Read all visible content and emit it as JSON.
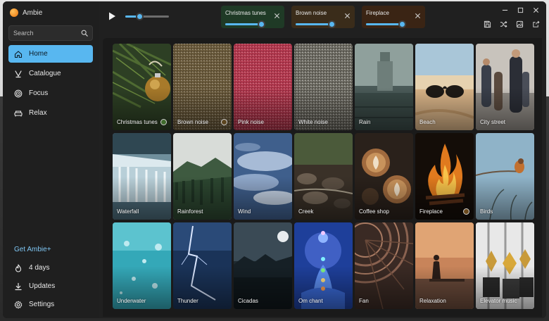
{
  "app": {
    "title": "Ambie"
  },
  "search": {
    "placeholder": "Search"
  },
  "nav": [
    {
      "label": "Home",
      "icon": "home-icon",
      "active": true
    },
    {
      "label": "Catalogue",
      "icon": "catalogue-icon",
      "active": false
    },
    {
      "label": "Focus",
      "icon": "focus-icon",
      "active": false
    },
    {
      "label": "Relax",
      "icon": "relax-icon",
      "active": false
    }
  ],
  "bottom_nav": {
    "get_plus": "Get Ambie+",
    "streak": "4 days",
    "updates": "Updates",
    "settings": "Settings"
  },
  "player": {
    "master_volume": 0.32
  },
  "active_sounds": [
    {
      "name": "Christmas tunes",
      "volume": 0.93,
      "tint": "#1f3a26"
    },
    {
      "name": "Brown noise",
      "volume": 0.93,
      "tint": "#3a2c1a"
    },
    {
      "name": "Fireplace",
      "volume": 0.93,
      "tint": "#3a2414"
    }
  ],
  "colors": {
    "accent": "#58b7f0",
    "window": "#1c1c1c",
    "sidebar": "#1f1f1f"
  },
  "sounds": [
    {
      "name": "Christmas tunes",
      "art": "christmas",
      "playing": true,
      "dot": "#3f6b2c"
    },
    {
      "name": "Brown noise",
      "art": "brown",
      "playing": true,
      "dot": "#5c4520"
    },
    {
      "name": "Pink noise",
      "art": "pink",
      "playing": false
    },
    {
      "name": "White noise",
      "art": "white",
      "playing": false
    },
    {
      "name": "Rain",
      "art": "rain",
      "playing": false
    },
    {
      "name": "Beach",
      "art": "beach",
      "playing": false
    },
    {
      "name": "City street",
      "art": "city",
      "playing": false
    },
    {
      "name": "Waterfall",
      "art": "waterfall",
      "playing": false
    },
    {
      "name": "Rainforest",
      "art": "rainforest",
      "playing": false
    },
    {
      "name": "Wind",
      "art": "wind",
      "playing": false
    },
    {
      "name": "Creek",
      "art": "creek",
      "playing": false
    },
    {
      "name": "Coffee shop",
      "art": "coffee",
      "playing": false
    },
    {
      "name": "Fireplace",
      "art": "fireplace",
      "playing": true,
      "dot": "#6b4a1e"
    },
    {
      "name": "Birds",
      "art": "birds",
      "playing": false
    },
    {
      "name": "Underwater",
      "art": "underwater",
      "playing": false
    },
    {
      "name": "Thunder",
      "art": "thunder",
      "playing": false
    },
    {
      "name": "Cicadas",
      "art": "cicadas",
      "playing": false
    },
    {
      "name": "Om chant",
      "art": "om",
      "playing": false
    },
    {
      "name": "Fan",
      "art": "fan",
      "playing": false
    },
    {
      "name": "Relaxation",
      "art": "relaxation",
      "playing": false
    },
    {
      "name": "Elevator music",
      "art": "elevator",
      "playing": false
    }
  ]
}
